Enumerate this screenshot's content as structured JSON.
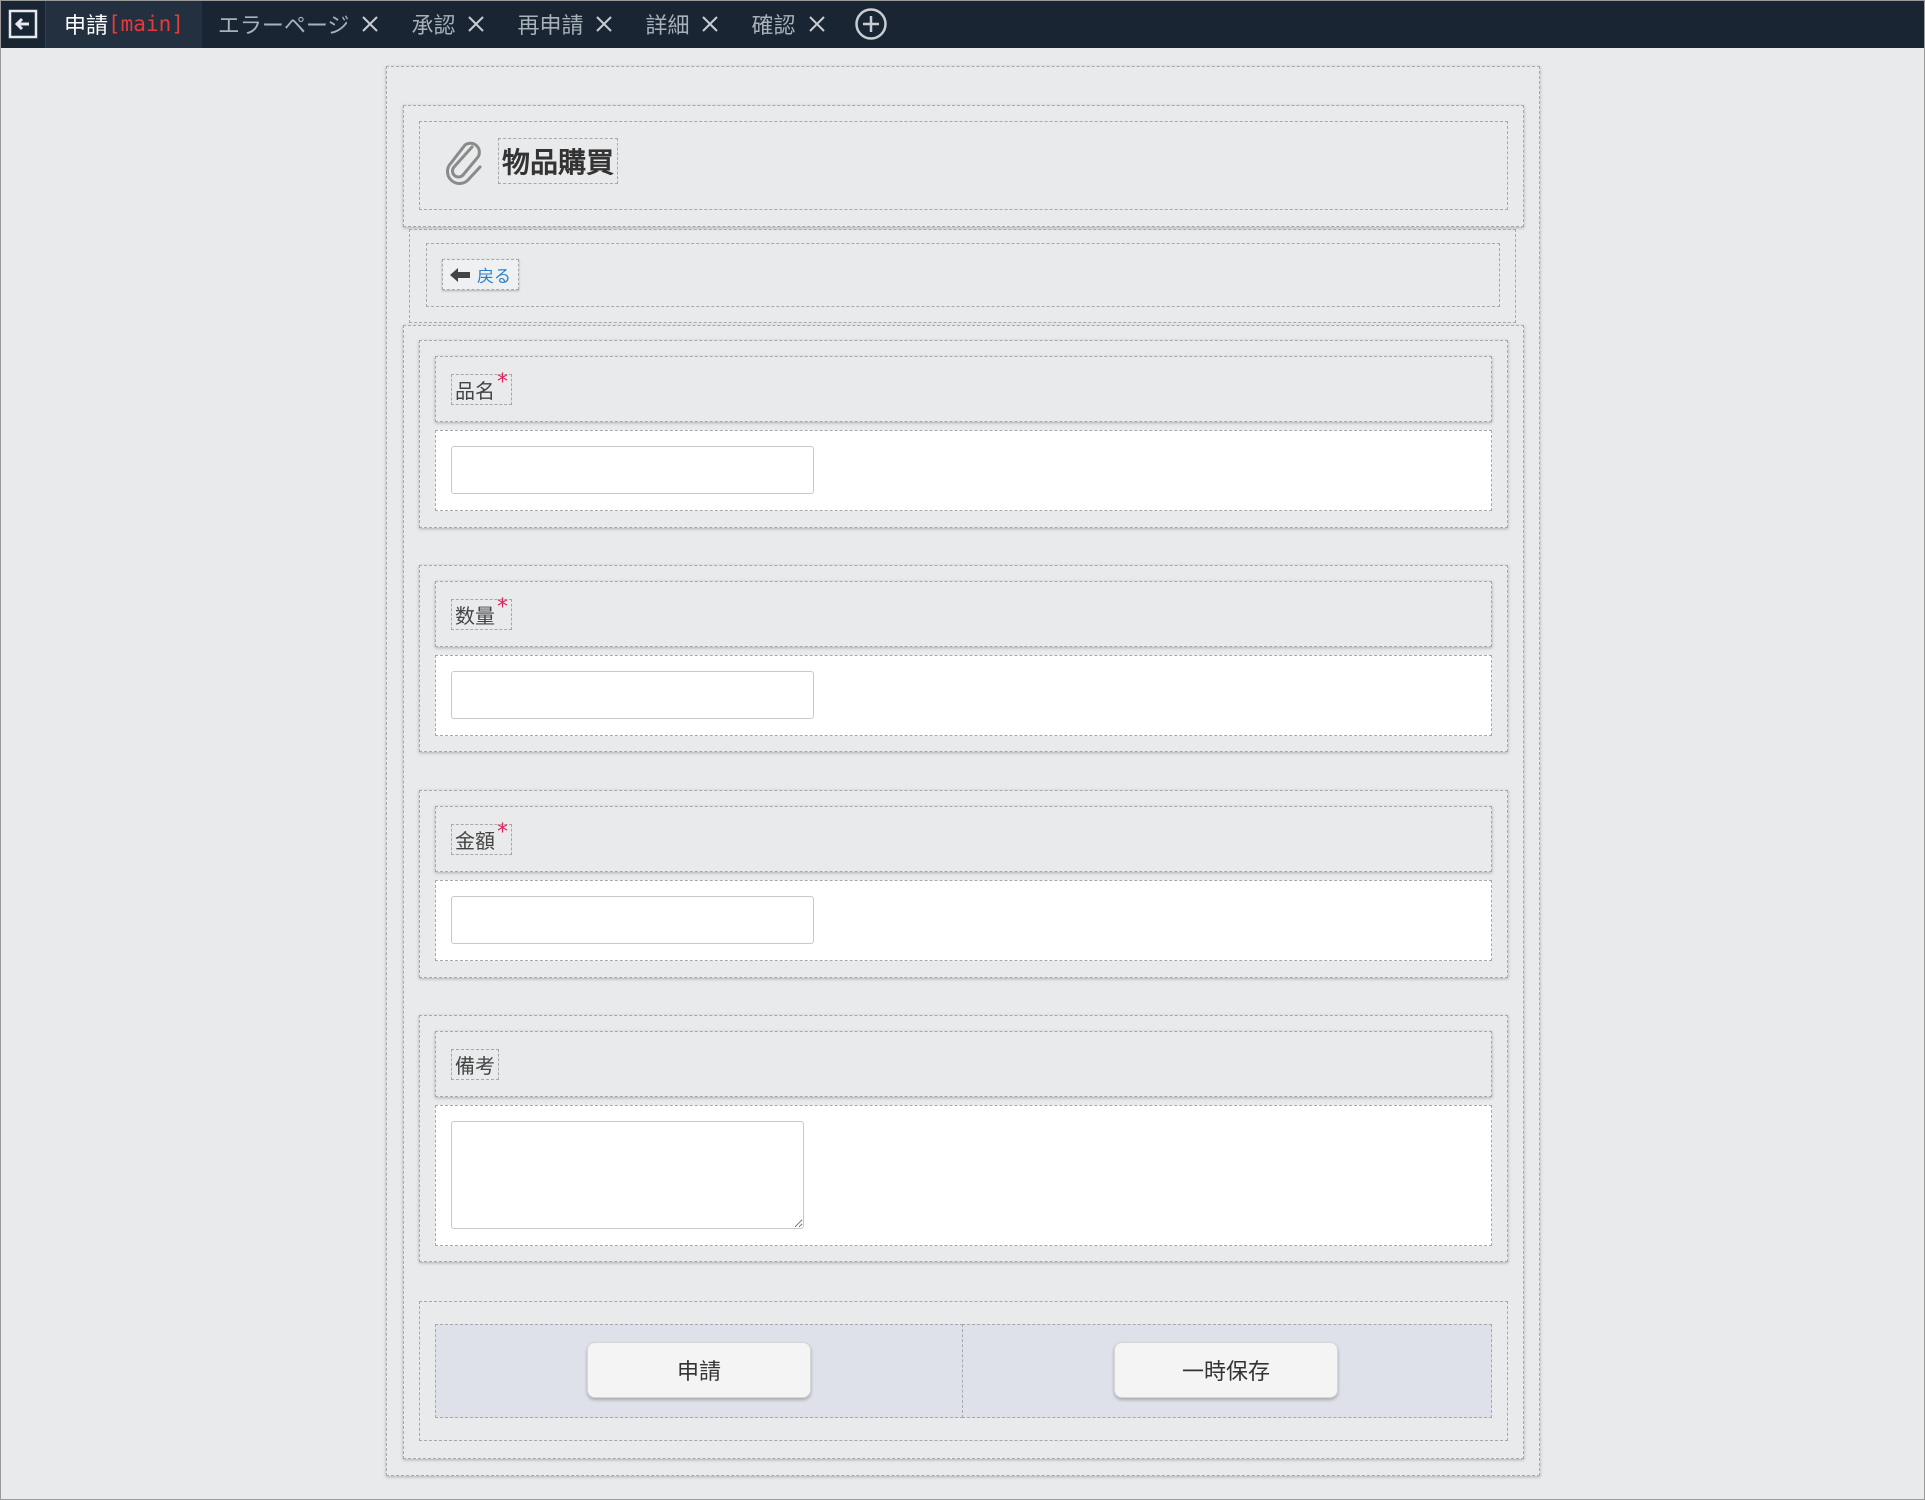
{
  "tabs": [
    {
      "label": "申請",
      "tag": "[main]",
      "active": true,
      "closable": false
    },
    {
      "label": "エラーページ",
      "closable": true
    },
    {
      "label": "承認",
      "closable": true
    },
    {
      "label": "再申請",
      "closable": true
    },
    {
      "label": "詳細",
      "closable": true
    },
    {
      "label": "確認",
      "closable": true
    }
  ],
  "page": {
    "title": "物品購買",
    "title_icon": "paperclip-icon",
    "back_label": "戻る"
  },
  "fields": [
    {
      "label": "品名",
      "required_mark": "*",
      "value": ""
    },
    {
      "label": "数量",
      "required_mark": "*",
      "value": ""
    },
    {
      "label": "金額",
      "required_mark": "*",
      "value": ""
    },
    {
      "label": "備考",
      "value": ""
    }
  ],
  "actions": {
    "submit_label": "申請",
    "save_draft_label": "一時保存"
  },
  "colors": {
    "tabbar_bg": "#1a2533",
    "main_tag": "#e33b3b",
    "required": "#e0245e",
    "link": "#2f7fc8"
  }
}
